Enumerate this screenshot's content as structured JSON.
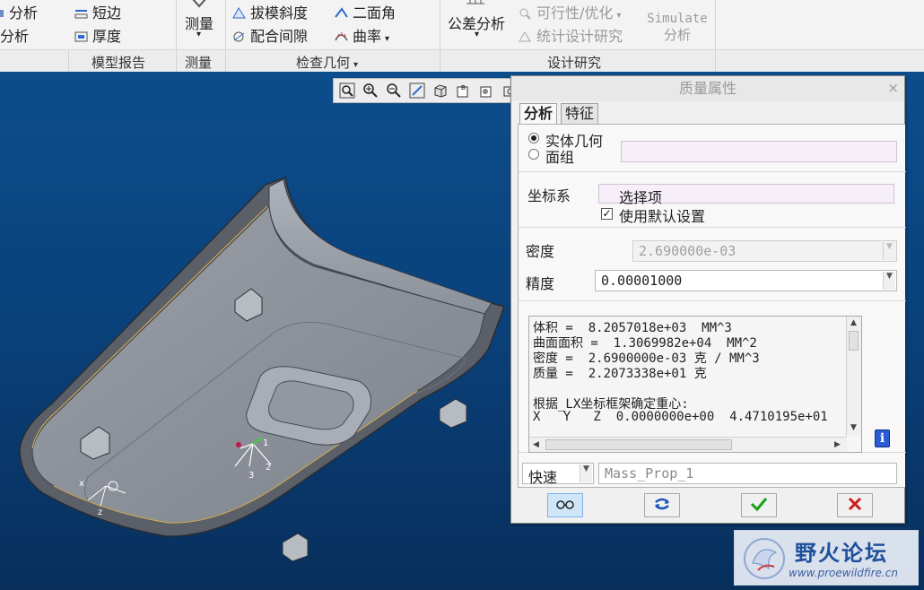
{
  "ribbon": {
    "items": {
      "analysis_top": "分析",
      "analysis_bottom": "分析",
      "short_edge": "短边",
      "thickness": "厚度",
      "measure": "测量",
      "draft": "拔模斜度",
      "fit_gap": "配合间隙",
      "dihedral": "二面角",
      "curvature": "曲率",
      "tolerance_analysis": "公差分析",
      "feasibility": "可行性/优化",
      "statistical_design": "统计设计研究",
      "simulate_line1": "Simulate",
      "simulate_line2": "分析"
    },
    "groups": {
      "model_report": "模型报告",
      "measure": "测量",
      "inspect_geometry": "检查几何",
      "design_study": "设计研究"
    }
  },
  "dialog": {
    "title": "质量属性",
    "tabs": [
      "分析",
      "特征"
    ],
    "solid_geometry": "实体几何",
    "quilt": "面组",
    "csys_label": "坐标系",
    "csys_value": "选择项",
    "use_default": "使用默认设置",
    "density_label": "密度",
    "density_value": "2.690000e-03",
    "accuracy_label": "精度",
    "accuracy_value": "0.00001000",
    "results": [
      "体积 =  8.2057018e+03  MM^3",
      "曲面面积 =  1.3069982e+04  MM^2",
      "密度 =  2.6900000e-03 克 / MM^3",
      "质量 =  2.2073338e+01 克",
      "",
      "根据_LX坐标框架确定重心:",
      "X   Y   Z  0.0000000e+00  4.4710195e+01"
    ],
    "mode": "快速",
    "feature_name": "Mass_Prop_1"
  },
  "viewport": {
    "triad_labels": [
      "1",
      "2",
      "3"
    ],
    "csys_label": "z"
  },
  "watermark": {
    "title": "野火论坛",
    "url": "www.proewildfire.cn"
  }
}
